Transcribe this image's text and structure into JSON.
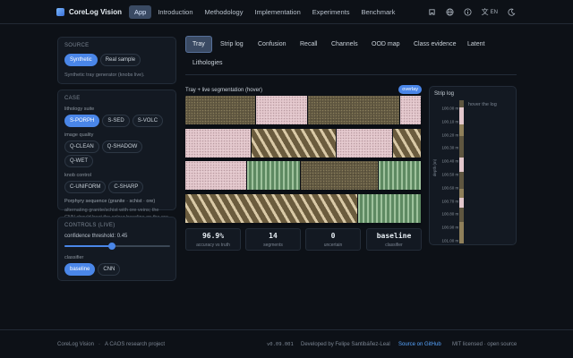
{
  "nav": {
    "brand": "CoreLog Vision",
    "links": [
      "App",
      "Introduction",
      "Methodology",
      "Implementation",
      "Experiments",
      "Benchmark"
    ],
    "lang": "EN"
  },
  "source": {
    "title": "SOURCE",
    "options": [
      "Synthetic",
      "Real sample"
    ],
    "selected": "Synthetic",
    "helper": "Synthetic tray generator (knobs live)."
  },
  "case": {
    "title": "CASE",
    "lithology_label": "lithology suite",
    "lithology_options": [
      "S-PORPH",
      "S-SED",
      "S-VOLC"
    ],
    "image_quality_label": "image quality",
    "image_quality_options": [
      "Q-CLEAN",
      "Q-SHADOW",
      "Q-WET"
    ],
    "knob_label": "knob control",
    "knob_options": [
      "C-UNIFORM",
      "C-SHARP"
    ],
    "description": "Porphyry sequence (granite · schist · ore)",
    "description2": "alternating granite/schist with ore veins; the CNN should beat the colour baseline on the ore"
  },
  "controls": {
    "title": "CONTROLS (LIVE)",
    "threshold_label": "confidence threshold: 0.45",
    "threshold_value": 0.45,
    "classifier_label": "classifier",
    "classifier_options": [
      "baseline",
      "CNN"
    ],
    "classifier_selected": "baseline"
  },
  "tabs": {
    "row1": [
      "Tray",
      "Strip log",
      "Confusion",
      "Recall",
      "Channels",
      "OOD map",
      "Class evidence",
      "Latent"
    ],
    "row2": [
      "Lithologies"
    ],
    "active": "Tray"
  },
  "tray": {
    "title": "Tray + live segmentation (hover)",
    "overlay_label": "overlay",
    "rows": [
      [
        {
          "type": "ore",
          "w": 30
        },
        {
          "type": "granite",
          "w": 22
        },
        {
          "type": "ore",
          "w": 39
        },
        {
          "type": "granite",
          "w": 9
        }
      ],
      [
        {
          "type": "granite",
          "w": 28
        },
        {
          "type": "schist",
          "w": 36
        },
        {
          "type": "granite",
          "w": 24
        },
        {
          "type": "schist",
          "w": 12
        }
      ],
      [
        {
          "type": "granite",
          "w": 26
        },
        {
          "type": "schist-g",
          "w": 23
        },
        {
          "type": "ore",
          "w": 33
        },
        {
          "type": "schist-g",
          "w": 18
        }
      ],
      [
        {
          "type": "schist",
          "w": 73
        },
        {
          "type": "schist-g",
          "w": 27
        }
      ]
    ]
  },
  "metrics": [
    {
      "value": "96.9%",
      "label": "accuracy vs truth"
    },
    {
      "value": "14",
      "label": "segments"
    },
    {
      "value": "0",
      "label": "uncertain"
    },
    {
      "value": "baseline",
      "label": "classifier"
    }
  ],
  "strip_log": {
    "title": "Strip log",
    "hint": "hover the log",
    "ylabel": "depth (m)",
    "ticks": [
      "100.00 m",
      "100.10 m",
      "100.20 m",
      "100.30 m",
      "100.40 m",
      "100.50 m",
      "100.60 m",
      "100.70 m",
      "100.80 m",
      "100.90 m",
      "101.00 m"
    ],
    "column": [
      {
        "type": "ore",
        "frac": 0.05
      },
      {
        "type": "granite",
        "frac": 0.12
      },
      {
        "type": "schist",
        "frac": 0.08
      },
      {
        "type": "ore",
        "frac": 0.15
      },
      {
        "type": "granite",
        "frac": 0.1
      },
      {
        "type": "ore",
        "frac": 0.12
      },
      {
        "type": "schist",
        "frac": 0.06
      },
      {
        "type": "granite",
        "frac": 0.07
      },
      {
        "type": "ore",
        "frac": 0.1
      },
      {
        "type": "schist",
        "frac": 0.15
      }
    ],
    "colors": {
      "granite": "#e3c7cc",
      "ore": "#5f5640",
      "schist": "#8f7f5a"
    }
  },
  "footer": {
    "left": "CoreLog Vision",
    "sep": "·",
    "tagline": "A CAOS research project",
    "version": "v0.09.001",
    "developer": "Developed by Felipe Santibáñez-Leal",
    "github": "Source on GitHub",
    "license": "MIT licensed · open source"
  }
}
